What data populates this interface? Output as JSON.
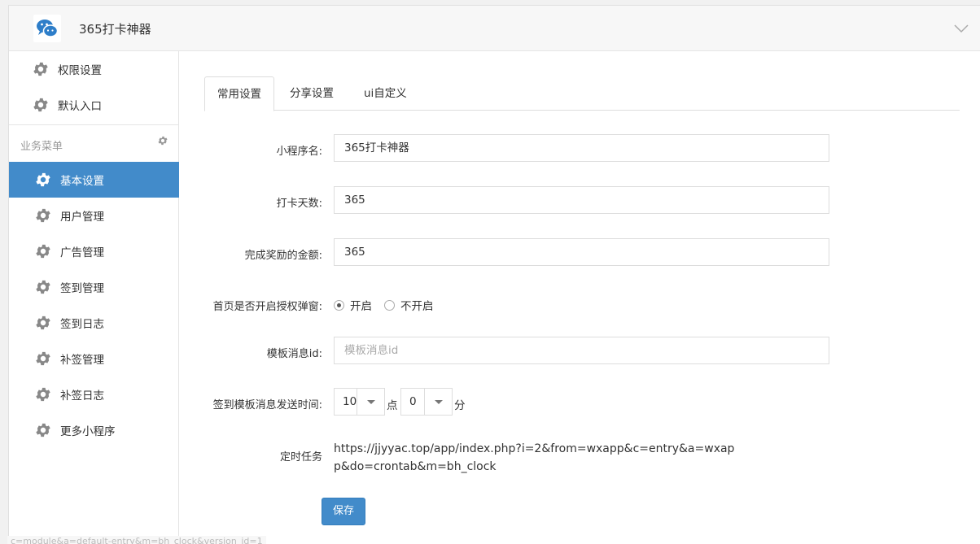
{
  "header": {
    "app_title": "365打卡神器"
  },
  "sidebar": {
    "top_items": [
      {
        "label": "权限设置"
      },
      {
        "label": "默认入口"
      }
    ],
    "group_title": "业务菜单",
    "items": [
      {
        "label": "基本设置",
        "active": true
      },
      {
        "label": "用户管理"
      },
      {
        "label": "广告管理"
      },
      {
        "label": "签到管理"
      },
      {
        "label": "签到日志"
      },
      {
        "label": "补签管理"
      },
      {
        "label": "补签日志"
      },
      {
        "label": "更多小程序"
      }
    ]
  },
  "tabs": [
    {
      "label": "常用设置",
      "active": true
    },
    {
      "label": "分享设置"
    },
    {
      "label": "ui自定义"
    }
  ],
  "form": {
    "app_name": {
      "label": "小程序名:",
      "value": "365打卡神器"
    },
    "checkin_days": {
      "label": "打卡天数:",
      "value": "365"
    },
    "reward_amount": {
      "label": "完成奖励的金额:",
      "value": "365"
    },
    "auth_popup": {
      "label": "首页是否开启授权弹窗:",
      "options": [
        "开启",
        "不开启"
      ],
      "selected": "开启"
    },
    "template_id": {
      "label": "模板消息id:",
      "placeholder": "模板消息id"
    },
    "send_time": {
      "label": "签到模板消息发送时间:",
      "hour": "10",
      "hour_unit": "点",
      "minute": "0",
      "minute_unit": "分"
    },
    "cron": {
      "label": "定时任务",
      "url": "https://jjyyac.top/app/index.php?i=2&from=wxapp&c=entry&a=wxapp&do=crontab&m=bh_clock"
    }
  },
  "save_label": "保存",
  "status_bar_url": "c=module&a=default-entry&m=bh_clock&version_id=1",
  "colors": {
    "accent": "#428bca"
  }
}
